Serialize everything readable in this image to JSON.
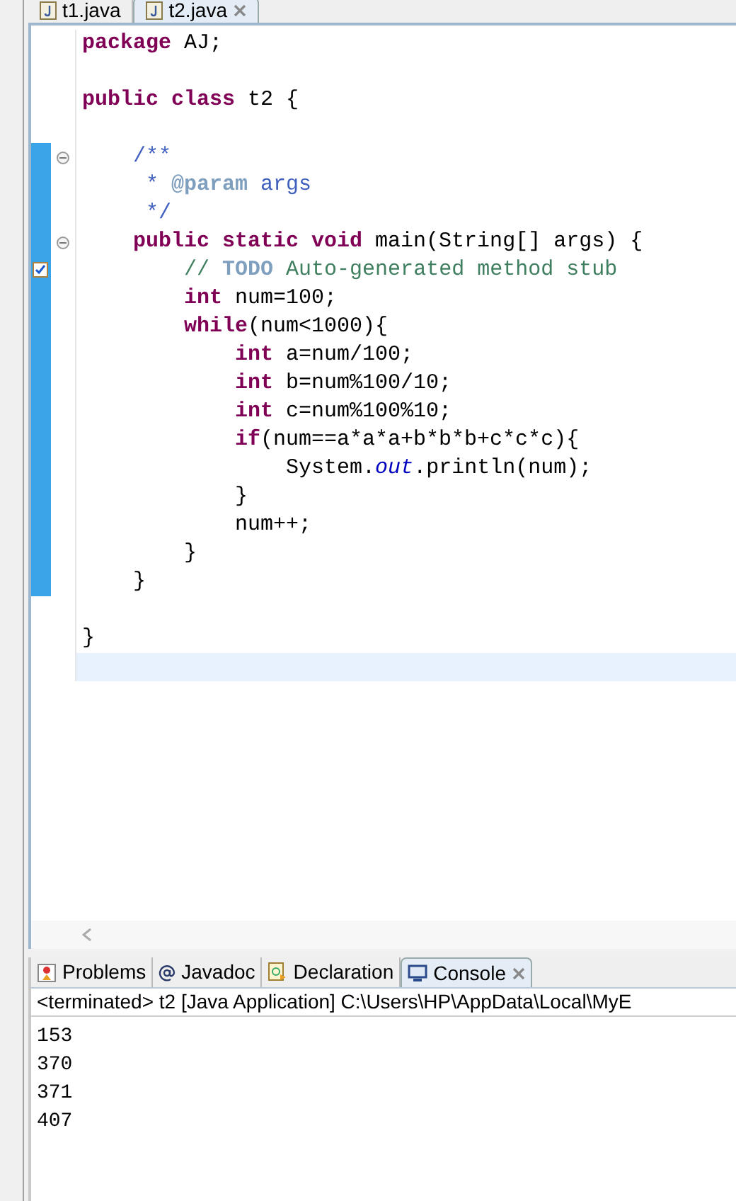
{
  "editor_tabs": [
    {
      "label": "t1.java",
      "selected": false,
      "closable": false
    },
    {
      "label": "t2.java",
      "selected": true,
      "closable": true
    }
  ],
  "code_lines": [
    {
      "changed": false,
      "fold": false,
      "task": false,
      "current": false,
      "tokens": [
        {
          "kind": "keyword",
          "text": "package"
        },
        {
          "kind": "plain",
          "text": " AJ;"
        }
      ]
    },
    {
      "changed": false,
      "fold": false,
      "task": false,
      "current": false
    },
    {
      "changed": false,
      "fold": false,
      "task": false,
      "current": false,
      "tokens": [
        {
          "kind": "keyword",
          "text": "public class"
        },
        {
          "kind": "plain",
          "text": " t2 {"
        }
      ]
    },
    {
      "changed": false,
      "fold": false,
      "task": false,
      "current": false
    },
    {
      "changed": true,
      "fold": true,
      "task": false,
      "current": false,
      "tokens": [
        {
          "kind": "javadoc",
          "text": "    /**"
        }
      ]
    },
    {
      "changed": true,
      "fold": false,
      "task": false,
      "current": false,
      "tokens": [
        {
          "kind": "javadoc",
          "text": "     * "
        },
        {
          "kind": "javadoc_tag",
          "text": "@param"
        },
        {
          "kind": "javadoc",
          "text": " args"
        }
      ]
    },
    {
      "changed": true,
      "fold": false,
      "task": false,
      "current": false,
      "tokens": [
        {
          "kind": "javadoc",
          "text": "     */"
        }
      ]
    },
    {
      "changed": true,
      "fold": true,
      "task": false,
      "current": false,
      "tokens": [
        {
          "kind": "keyword",
          "text": "    public static void"
        },
        {
          "kind": "plain",
          "text": " main(String[] args) {"
        }
      ]
    },
    {
      "changed": true,
      "fold": false,
      "task": true,
      "current": false,
      "tokens": [
        {
          "kind": "comment",
          "text": "        // "
        },
        {
          "kind": "todo",
          "text": "TODO"
        },
        {
          "kind": "comment",
          "text": " Auto-generated method stub"
        }
      ]
    },
    {
      "changed": true,
      "fold": false,
      "task": false,
      "current": false,
      "tokens": [
        {
          "kind": "keyword",
          "text": "        int"
        },
        {
          "kind": "plain",
          "text": " num=100;"
        }
      ]
    },
    {
      "changed": true,
      "fold": false,
      "task": false,
      "current": false,
      "tokens": [
        {
          "kind": "keyword",
          "text": "        while"
        },
        {
          "kind": "plain",
          "text": "(num<1000){"
        }
      ]
    },
    {
      "changed": true,
      "fold": false,
      "task": false,
      "current": false,
      "tokens": [
        {
          "kind": "keyword",
          "text": "            int"
        },
        {
          "kind": "plain",
          "text": " a=num/100;"
        }
      ]
    },
    {
      "changed": true,
      "fold": false,
      "task": false,
      "current": false,
      "tokens": [
        {
          "kind": "keyword",
          "text": "            int"
        },
        {
          "kind": "plain",
          "text": " b=num%100/10;"
        }
      ]
    },
    {
      "changed": true,
      "fold": false,
      "task": false,
      "current": false,
      "tokens": [
        {
          "kind": "keyword",
          "text": "            int"
        },
        {
          "kind": "plain",
          "text": " c=num%100%10;"
        }
      ]
    },
    {
      "changed": true,
      "fold": false,
      "task": false,
      "current": false,
      "tokens": [
        {
          "kind": "keyword",
          "text": "            if"
        },
        {
          "kind": "plain",
          "text": "(num==a*a*a+b*b*b+c*c*c){"
        }
      ]
    },
    {
      "changed": true,
      "fold": false,
      "task": false,
      "current": false,
      "tokens": [
        {
          "kind": "plain",
          "text": "                System."
        },
        {
          "kind": "field",
          "text": "out"
        },
        {
          "kind": "plain",
          "text": ".println(num);"
        }
      ]
    },
    {
      "changed": true,
      "fold": false,
      "task": false,
      "current": false,
      "tokens": [
        {
          "kind": "plain",
          "text": "            }"
        }
      ]
    },
    {
      "changed": true,
      "fold": false,
      "task": false,
      "current": false,
      "tokens": [
        {
          "kind": "plain",
          "text": "            num++;"
        }
      ]
    },
    {
      "changed": true,
      "fold": false,
      "task": false,
      "current": false,
      "tokens": [
        {
          "kind": "plain",
          "text": "        }"
        }
      ]
    },
    {
      "changed": true,
      "fold": false,
      "task": false,
      "current": false,
      "tokens": [
        {
          "kind": "plain",
          "text": "    }"
        }
      ]
    },
    {
      "changed": false,
      "fold": false,
      "task": false,
      "current": false
    },
    {
      "changed": false,
      "fold": false,
      "task": false,
      "current": false,
      "tokens": [
        {
          "kind": "plain",
          "text": "}"
        }
      ]
    },
    {
      "changed": false,
      "fold": false,
      "task": false,
      "current": true
    }
  ],
  "view_tabs": [
    {
      "kind": "problems",
      "label": "Problems",
      "selected": false,
      "closable": false
    },
    {
      "kind": "javadoc",
      "label": "Javadoc",
      "selected": false,
      "closable": false
    },
    {
      "kind": "declaration",
      "label": "Declaration",
      "selected": false,
      "closable": false
    },
    {
      "kind": "console",
      "label": "Console",
      "selected": true,
      "closable": true
    }
  ],
  "console": {
    "header": "<terminated> t2 [Java Application] C:\\Users\\HP\\AppData\\Local\\MyE",
    "output": [
      "153",
      "370",
      "371",
      "407"
    ]
  }
}
